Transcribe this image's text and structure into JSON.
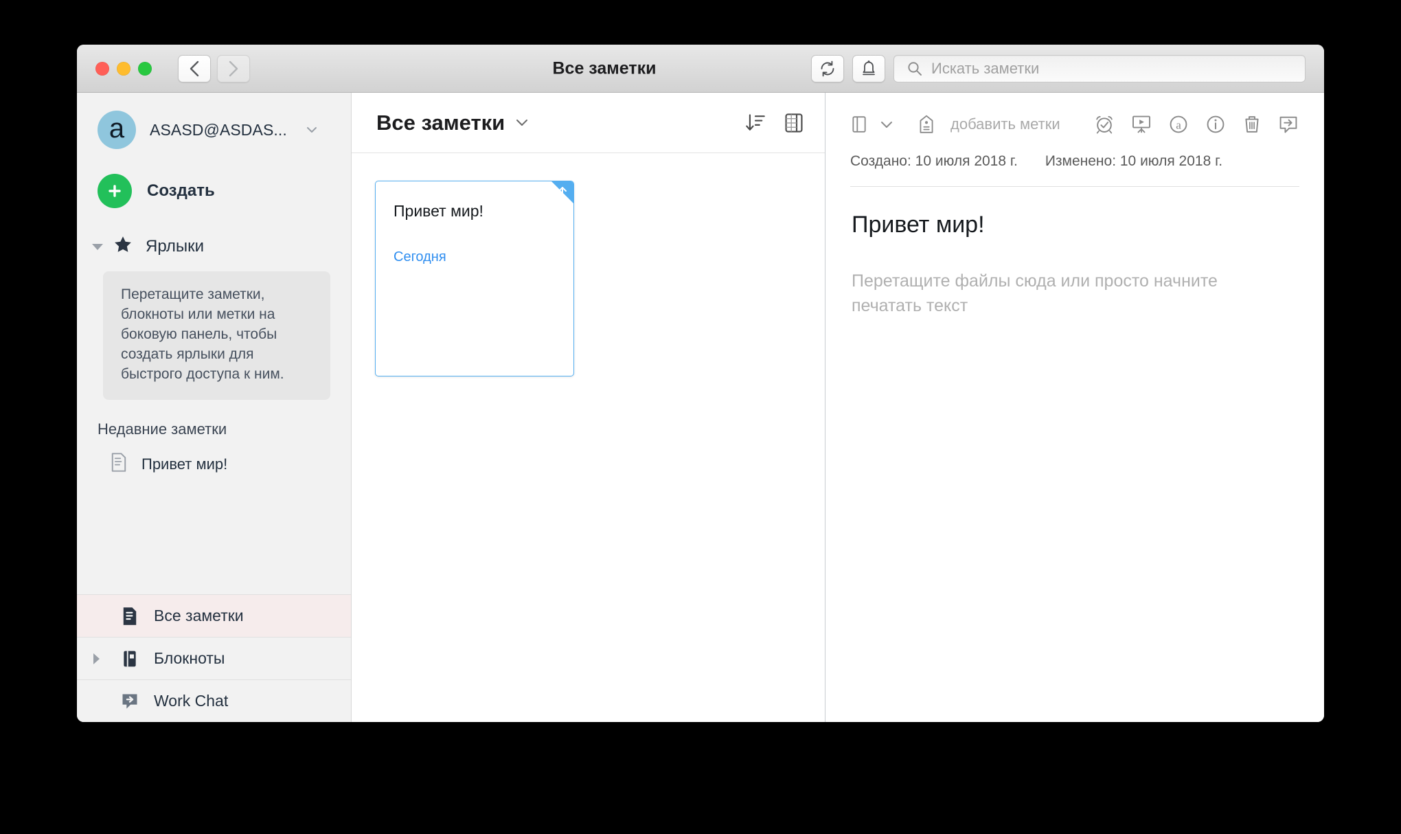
{
  "window": {
    "title": "Все заметки",
    "traffic_lights": [
      "close",
      "minimize",
      "zoom"
    ],
    "nav_back": "back-arrow",
    "nav_forward": "forward-arrow",
    "sync_icon": "sync-icon",
    "bell_icon": "bell-icon"
  },
  "search": {
    "placeholder": "Искать заметки",
    "value": "",
    "icon": "search-icon"
  },
  "sidebar": {
    "account": {
      "avatar_letter": "a",
      "email": "ASASD@ASDAS...",
      "chevron": "chevron-down-icon"
    },
    "create": {
      "label": "Создать",
      "icon": "plus-icon"
    },
    "shortcuts": {
      "label": "Ярлыки",
      "icon": "star-icon",
      "expanded": true,
      "hint": "Перетащите заметки, блокноты или метки на боковую панель, чтобы создать ярлыки для быстрого доступа к ним."
    },
    "recent": {
      "title": "Недавние заметки",
      "items": [
        {
          "label": "Привет мир!",
          "icon": "note-icon"
        }
      ]
    },
    "nav": [
      {
        "label": "Все заметки",
        "icon": "all-notes-icon",
        "selected": true,
        "has_twisty": false
      },
      {
        "label": "Блокноты",
        "icon": "notebook-icon",
        "selected": false,
        "has_twisty": true
      },
      {
        "label": "Work Chat",
        "icon": "work-chat-icon",
        "selected": false,
        "has_twisty": false
      }
    ]
  },
  "notelist": {
    "title": "Все заметки",
    "title_chevron": "chevron-down-icon",
    "sort_icon": "sort-descending-icon",
    "view_icon": "view-layout-icon",
    "notes": [
      {
        "title": "Привет мир!",
        "date": "Сегодня",
        "selected": true,
        "corner_icon": "arrow-up-icon"
      }
    ]
  },
  "editor": {
    "notebook_icon": "notebook-icon",
    "notebook_chevron": "chevron-down-icon",
    "tag_icon": "tag-icon",
    "tag_placeholder": "добавить метки",
    "actions": [
      {
        "name": "reminder-icon",
        "label": "Напоминание"
      },
      {
        "name": "presentation-icon",
        "label": "Презентация"
      },
      {
        "name": "annotate-icon",
        "label": "Аннотировать"
      },
      {
        "name": "info-icon",
        "label": "Информация"
      },
      {
        "name": "trash-icon",
        "label": "Удалить"
      },
      {
        "name": "share-chat-icon",
        "label": "Work Chat"
      }
    ],
    "created_label": "Создано: 10 июля 2018 г.",
    "modified_label": "Изменено: 10 июля 2018 г.",
    "title": "Привет мир!",
    "placeholder": "Перетащите файлы сюда или просто начните печатать текст"
  },
  "colors": {
    "accent_blue": "#54aef0",
    "create_green": "#22c05a",
    "avatar_blue": "#8fc6dd",
    "selected_row": "#f6ecec",
    "sidebar_bg": "#f2f2f2"
  }
}
